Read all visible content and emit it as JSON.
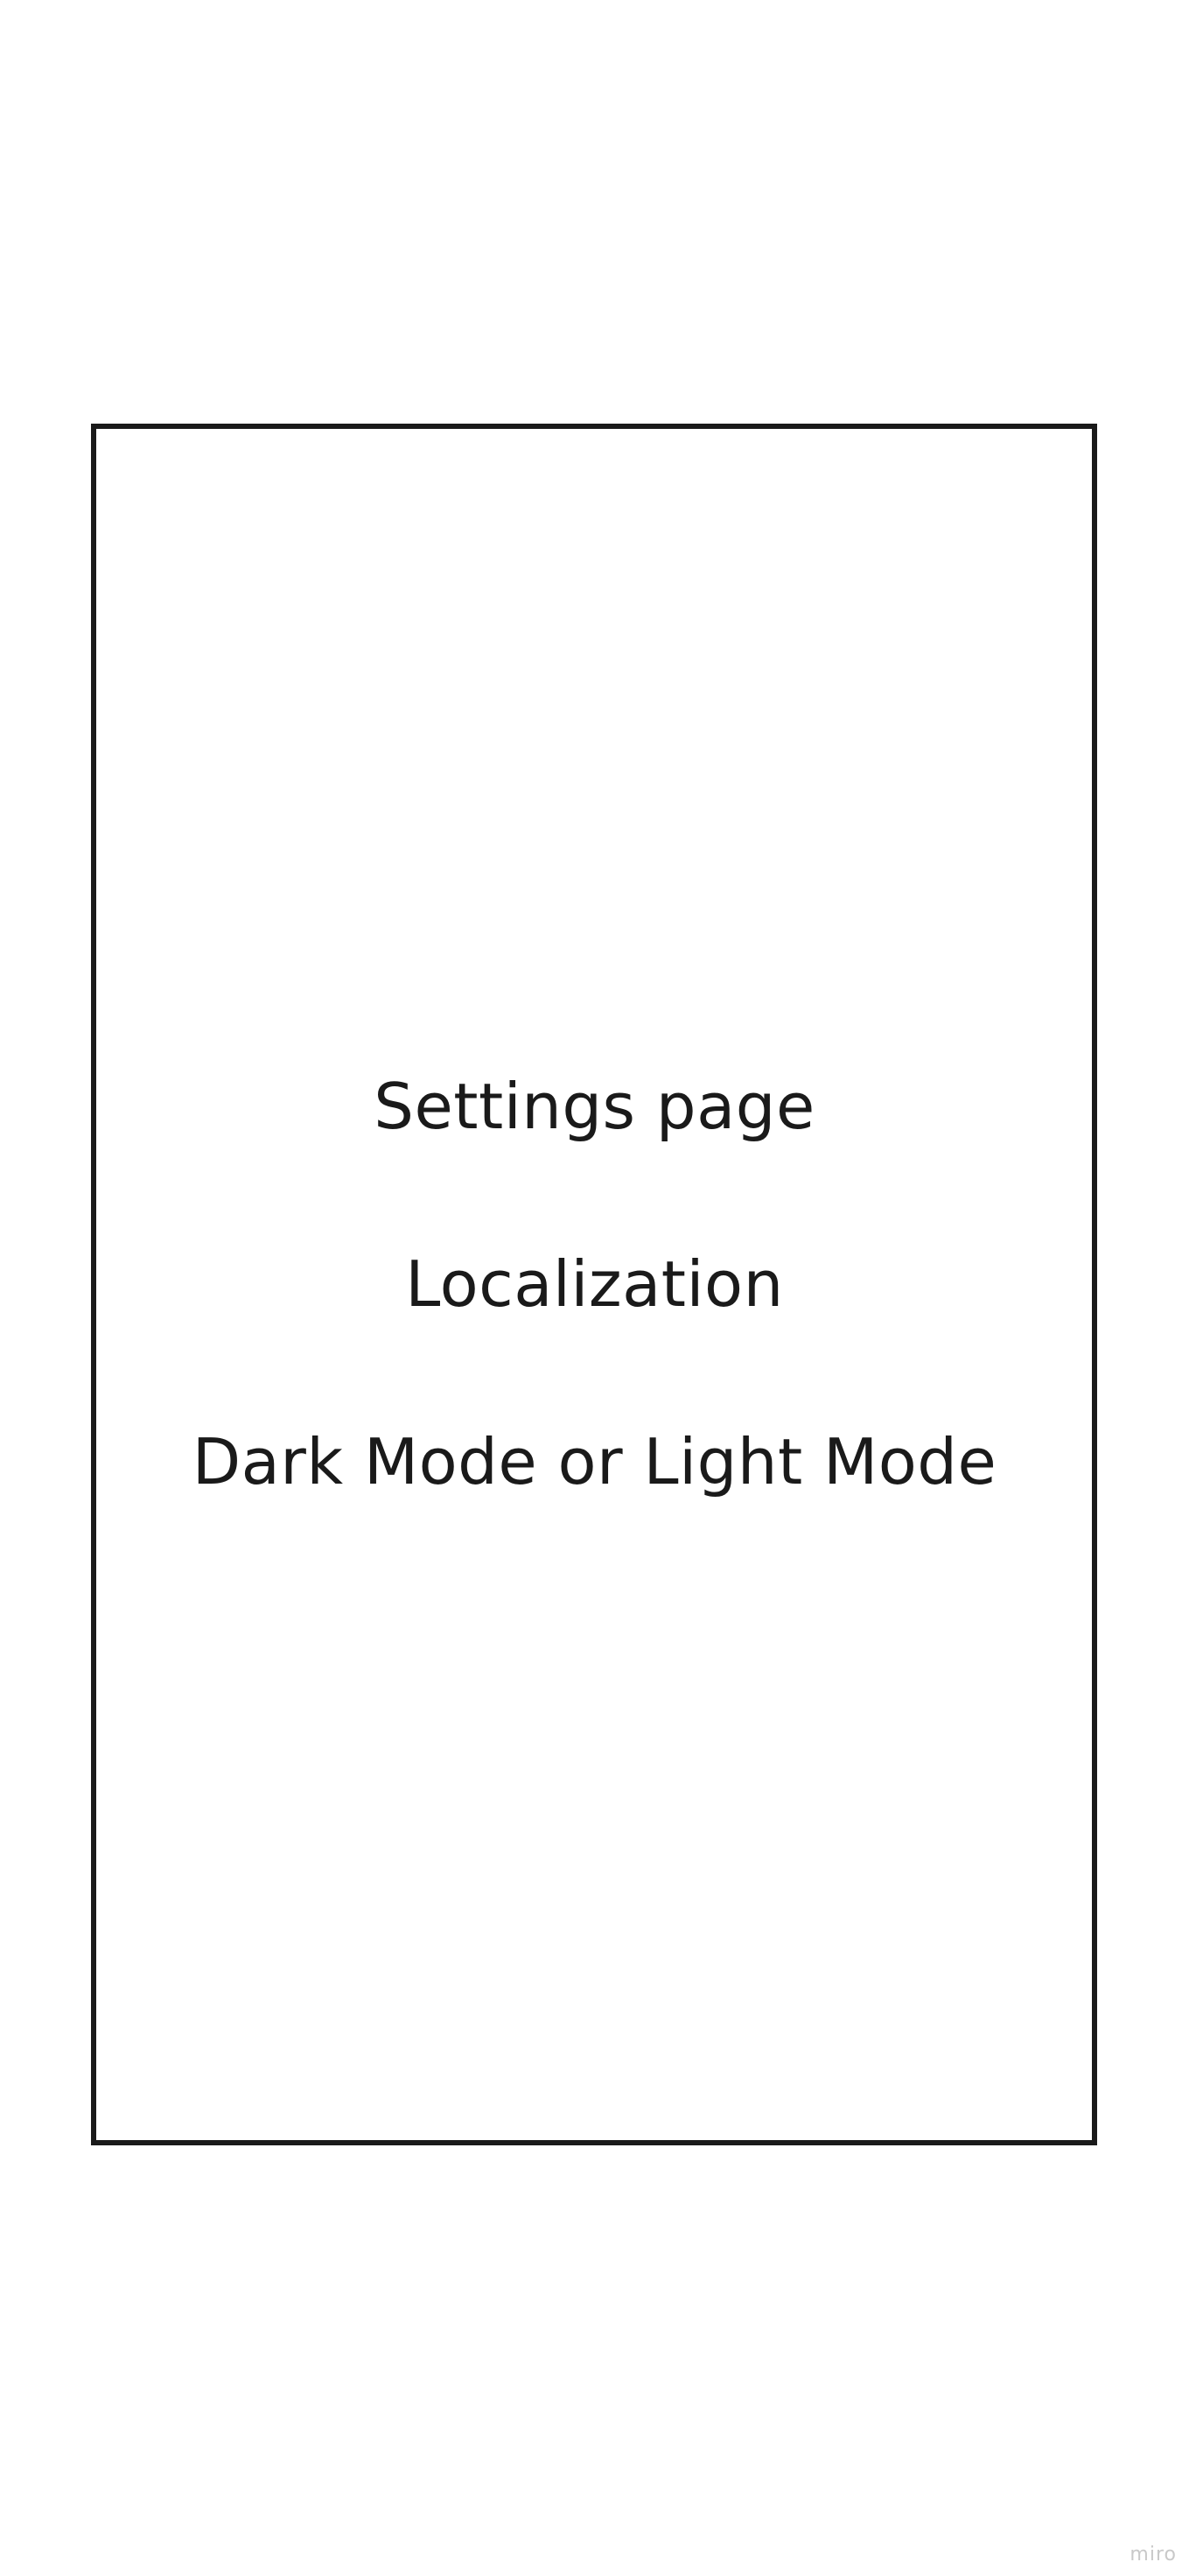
{
  "board": {
    "lines": [
      "Settings page",
      "Localization",
      "Dark Mode or Light Mode"
    ]
  },
  "watermark": "miro",
  "colors": {
    "background": "#ffffff",
    "stroke": "#1a1a1a",
    "text": "#1a1a1a",
    "watermark": "#c9c9c9"
  }
}
